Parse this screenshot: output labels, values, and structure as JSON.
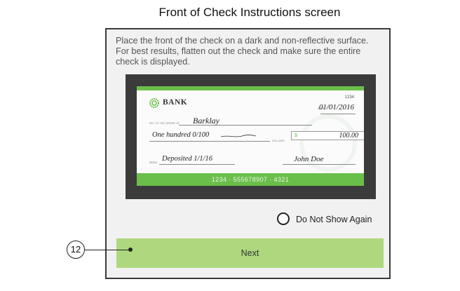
{
  "caption": "Front of Check Instructions screen",
  "instructions": "Place the front of the check on a dark and non-reflective surface. For best results, flatten out the check and make sure the entire check is displayed.",
  "check": {
    "bank_name": "BANK",
    "check_number": "1234",
    "date_label": "DATE",
    "date": "01/01/2016",
    "pay_to_label": "PAY TO THE ORDER OF",
    "payee": "Barklay",
    "amount_words": "One hundred 0/100",
    "dollars_label": "DOLLARS",
    "currency": "$",
    "amount": "100.00",
    "memo_label": "MEMO",
    "memo": "Deposited 1/1/16",
    "signature": "John Doe",
    "micr_line": "1234 · 555678907 · 4321",
    "accent_color": "#6abf4b"
  },
  "do_not_show_label": "Do Not Show Again",
  "next_label": "Next",
  "callout_number": "12"
}
